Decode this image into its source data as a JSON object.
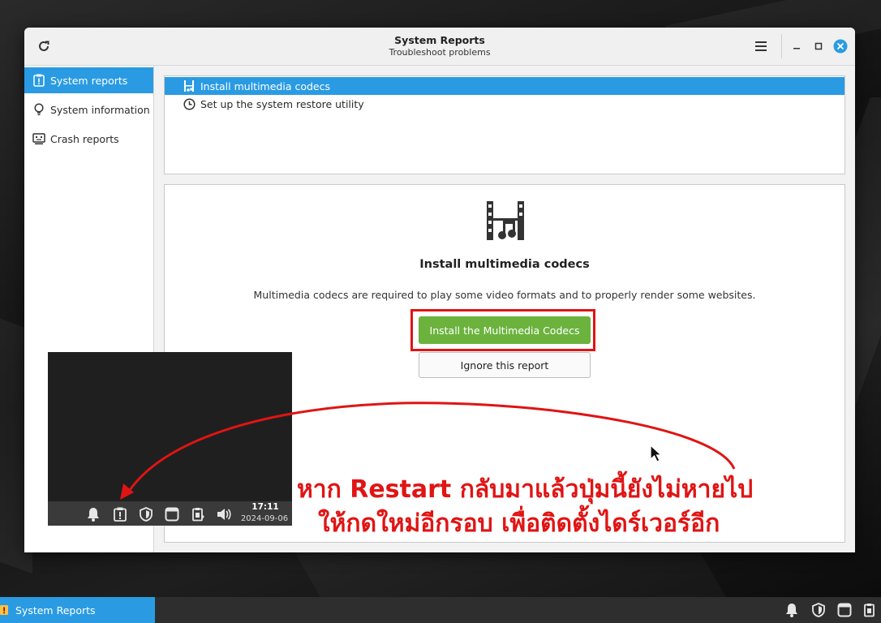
{
  "window": {
    "title": "System Reports",
    "subtitle": "Troubleshoot problems"
  },
  "sidebar": {
    "items": [
      {
        "label": "System reports",
        "icon": "report-icon",
        "active": true
      },
      {
        "label": "System information",
        "icon": "lightbulb-icon",
        "active": false
      },
      {
        "label": "Crash reports",
        "icon": "crash-screen-icon",
        "active": false
      }
    ]
  },
  "reports": {
    "items": [
      {
        "label": "Install multimedia codecs",
        "icon": "film-music-icon",
        "selected": true
      },
      {
        "label": "Set up the system restore utility",
        "icon": "clock-icon",
        "selected": false
      }
    ]
  },
  "detail": {
    "icon": "film-music-icon",
    "title": "Install multimedia codecs",
    "description": "Multimedia codecs are required to play some video formats and to properly render some websites.",
    "primary_button": "Install the Multimedia Codecs",
    "secondary_button": "Ignore this report"
  },
  "inset": {
    "time": "17:11",
    "date": "2024-09-06",
    "tray_icons": [
      "bell-icon",
      "report-icon",
      "shield-icon",
      "window-icon",
      "clipboard-icon",
      "volume-icon"
    ]
  },
  "annotation": {
    "line1": "หาก Restart กลับมาแล้วปุ่มนี้ยังไม่หายไป",
    "line2": "ให้กดใหม่อีกรอบ เพื่อติดตั้งไดร์เวอร์อีก"
  },
  "taskbar": {
    "item_label": "System Reports",
    "tray_icons": [
      "bell-icon",
      "shield-icon",
      "window-icon",
      "clipboard-icon"
    ]
  },
  "colors": {
    "accent": "#2a9be3",
    "install_button": "#6cb33e",
    "annotation_red": "#e01414"
  }
}
